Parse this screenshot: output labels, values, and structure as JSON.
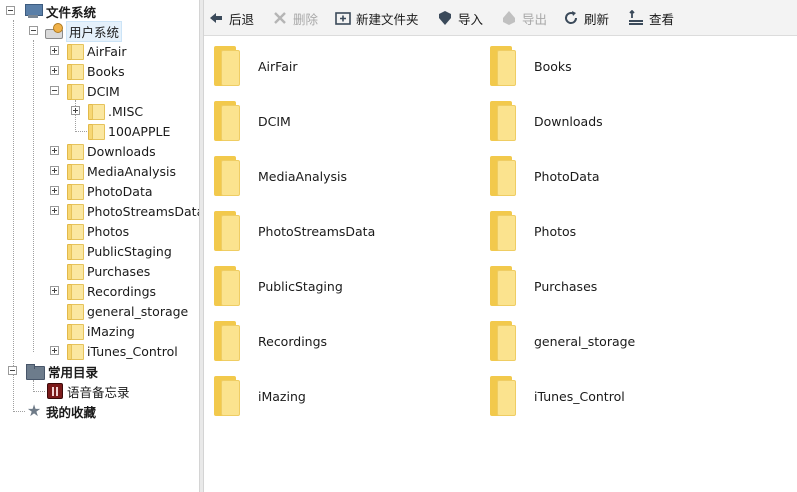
{
  "sidebar": {
    "root_file_system": "文件系统",
    "user_system": "用户系统",
    "folders": [
      "AirFair",
      "Books",
      "DCIM",
      "Downloads",
      "MediaAnalysis",
      "PhotoData",
      "PhotoStreamsData",
      "Photos",
      "PublicStaging",
      "Purchases",
      "Recordings",
      "general_storage",
      "iMazing",
      "iTunes_Control"
    ],
    "dcim_children": [
      ".MISC",
      "100APPLE"
    ],
    "common_dirs": "常用目录",
    "voice_memos": "语音备忘录",
    "favorites": "我的收藏"
  },
  "toolbar": {
    "back": "后退",
    "delete": "删除",
    "new_folder": "新建文件夹",
    "import": "导入",
    "export": "导出",
    "refresh": "刷新",
    "view": "查看"
  },
  "content": {
    "items": [
      "AirFair",
      "Books",
      "DCIM",
      "Downloads",
      "MediaAnalysis",
      "PhotoData",
      "PhotoStreamsData",
      "Photos",
      "PublicStaging",
      "Purchases",
      "Recordings",
      "general_storage",
      "iMazing",
      "iTunes_Control"
    ]
  },
  "colors": {
    "folder_back": "#f2c94c",
    "folder_front": "#fbe38e",
    "selection": "#e5f1fb",
    "toolbar_bg": "#f3f3f3"
  }
}
